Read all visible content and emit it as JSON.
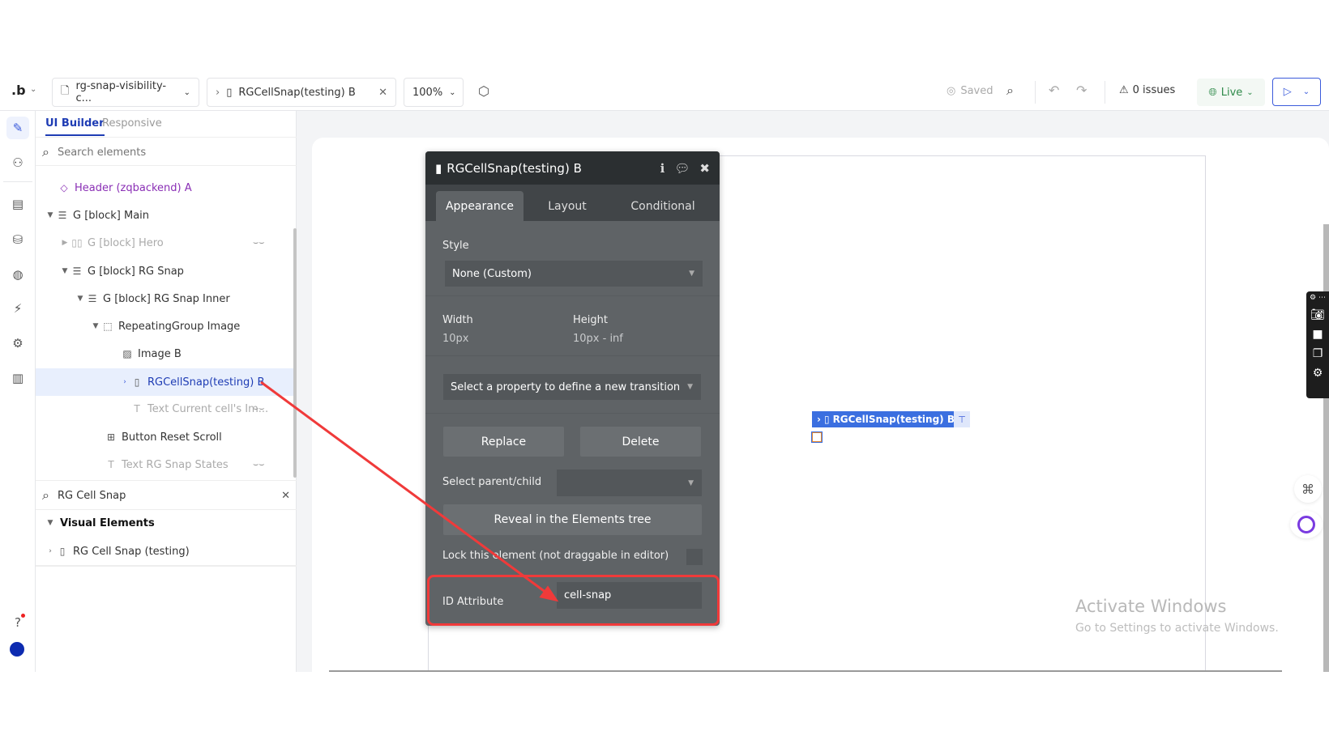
{
  "topbar": {
    "logo": ".b",
    "page_name": "rg-snap-visibility-c...",
    "breadcrumb_element": "RGCellSnap(testing) B",
    "zoom": "100%",
    "saved": "Saved",
    "issues": "0 issues",
    "live": "Live"
  },
  "sidebar": {
    "tabs": [
      "UI Builder",
      "Responsive"
    ],
    "search_placeholder": "Search elements",
    "tree": [
      {
        "label": "Header (zqbackend) A",
        "icon": "reusable-diamond-icon"
      },
      {
        "label": "G [block] Main",
        "icon": "group-icon",
        "caret": "down"
      },
      {
        "label": "G [block] Hero",
        "icon": "group-column-icon",
        "caret": "right",
        "hidden": true
      },
      {
        "label": "G [block] RG Snap",
        "icon": "group-icon",
        "caret": "down"
      },
      {
        "label": "G [block] RG Snap Inner",
        "icon": "group-icon",
        "caret": "down"
      },
      {
        "label": "RepeatingGroup Image",
        "icon": "repeating-group-icon",
        "caret": "down"
      },
      {
        "label": "Image B",
        "icon": "image-icon"
      },
      {
        "label": "RGCellSnap(testing) B",
        "icon": "plugin-element-icon",
        "caret": "right",
        "selected": true
      },
      {
        "label": "Text Current cell's Im...",
        "icon": "text-icon",
        "hidden": true
      },
      {
        "label": "Button Reset Scroll",
        "icon": "button-icon"
      },
      {
        "label": "Text RG Snap States",
        "icon": "text-icon",
        "hidden": true
      }
    ],
    "search2_value": "RG Cell Snap",
    "group_label": "Visual Elements",
    "result": "RG Cell Snap (testing)"
  },
  "panel": {
    "title": "RGCellSnap(testing) B",
    "tabs": [
      "Appearance",
      "Layout",
      "Conditional"
    ],
    "style_label": "Style",
    "style_value": "None (Custom)",
    "width_label": "Width",
    "width_value": "10px",
    "height_label": "Height",
    "height_value": "10px - inf",
    "transition_placeholder": "Select a property to define a new transition",
    "replace": "Replace",
    "delete": "Delete",
    "parent_child_label": "Select parent/child",
    "reveal": "Reveal in the Elements tree",
    "lock_label": "Lock this element (not draggable in editor)",
    "id_label": "ID Attribute",
    "id_value": "cell-snap"
  },
  "canvas": {
    "element_label": "RGCellSnap(testing) B"
  },
  "watermark": {
    "title": "Activate Windows",
    "subtitle": "Go to Settings to activate Windows."
  },
  "colors": {
    "accent": "#3b5bdb",
    "selected_bg": "#e8effd",
    "panel_bg": "#5f6366",
    "panel_header": "#2b2f31",
    "highlight": "#f03a3a",
    "live_green": "#2f8a4a"
  }
}
